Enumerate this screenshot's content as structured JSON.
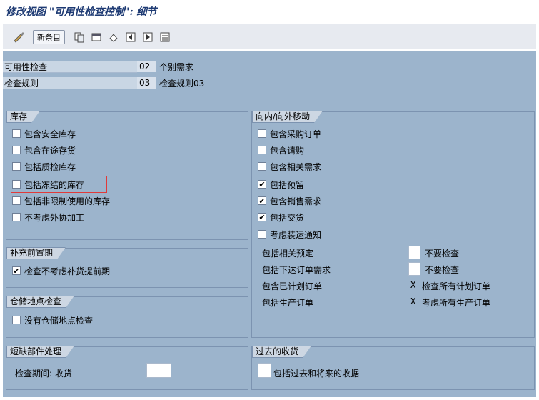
{
  "window_title": "修改视图 \"可用性检查控制\": 细节",
  "toolbar": {
    "new_entries_label": "新条目"
  },
  "header": {
    "availability_check_label": "可用性检查",
    "availability_check_code": "02",
    "availability_check_desc": "个别需求",
    "checking_rule_label": "检查规则",
    "checking_rule_code": "03",
    "checking_rule_desc": "检查规则03"
  },
  "stock": {
    "title": "库存",
    "items": [
      {
        "label": "包含安全库存",
        "checked": false
      },
      {
        "label": "包含在途存货",
        "checked": false
      },
      {
        "label": "包括质检库存",
        "checked": false
      },
      {
        "label": "包括冻结的库存",
        "checked": false
      },
      {
        "label": "包括非限制使用的库存",
        "checked": false
      },
      {
        "label": "不考虑外协加工",
        "checked": false
      }
    ]
  },
  "replenishment": {
    "title": "补充前置期",
    "items": [
      {
        "label": "检查不考虑补货提前期",
        "checked": true
      }
    ]
  },
  "storage": {
    "title": "仓储地点检查",
    "items": [
      {
        "label": "没有仓储地点检查",
        "checked": false
      }
    ]
  },
  "inout": {
    "title": "向内/向外移动",
    "items": [
      {
        "label": "包含采购订单",
        "checked": false
      },
      {
        "label": "包含请购",
        "checked": false
      },
      {
        "label": "包含相关需求",
        "checked": false
      },
      {
        "label": "包括预留",
        "checked": true
      },
      {
        "label": "包含销售需求",
        "checked": true
      },
      {
        "label": "包括交货",
        "checked": true
      },
      {
        "label": "考虑装运通知",
        "checked": false
      }
    ],
    "fields": [
      {
        "label": "包括相关预定",
        "value": "",
        "desc": "不要检查"
      },
      {
        "label": "包括下达订单需求",
        "value": "",
        "desc": "不要检查"
      },
      {
        "label": "包含已计划订单",
        "value": "X",
        "desc": "检查所有计划订单"
      },
      {
        "label": "包括生产订单",
        "value": "X",
        "desc": "考虑所有生产订单"
      }
    ]
  },
  "missing_parts": {
    "title": "短缺部件处理",
    "field_label": "检查期间: 收货",
    "field_value": ""
  },
  "past_receipts": {
    "title": "过去的收货",
    "field_value": "",
    "field_label": "包括过去和将来的收据"
  }
}
